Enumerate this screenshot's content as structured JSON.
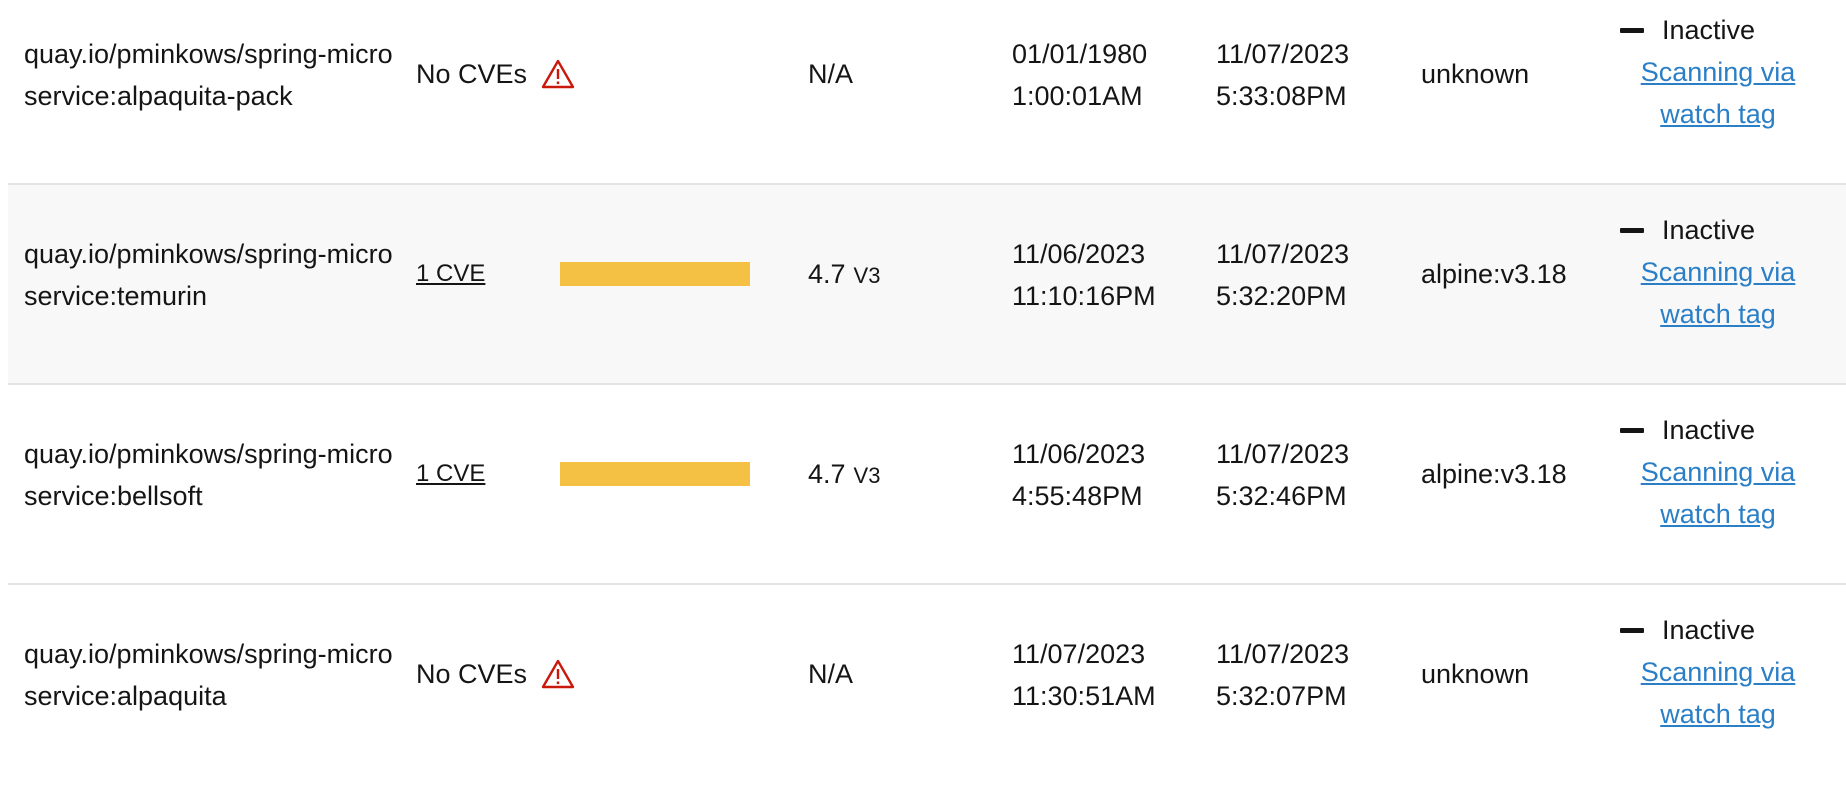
{
  "colors": {
    "severity_medium": "#f4c145",
    "link": "#2b7fc6",
    "warning": "#c9190b",
    "row_stripe": "#f8f8f8"
  },
  "icons": {
    "warning": "warning-triangle-icon",
    "status": "minus-icon"
  },
  "rows": [
    {
      "image": "quay.io/pminkows/spring-microservice:alpaquita-pack",
      "vulnerabilities": "No CVEs",
      "severity_fill": null,
      "score": "N/A",
      "score_version": "",
      "created": [
        "01/01/1980",
        "1:00:01AM"
      ],
      "modified": [
        "11/07/2023",
        "5:33:08PM"
      ],
      "base_image": "unknown",
      "status": "Inactive",
      "scan_link": "Scanning via watch tag"
    },
    {
      "image": "quay.io/pminkows/spring-microservice:temurin",
      "vulnerabilities": "1 CVE",
      "severity_fill": 1,
      "score": "4.7",
      "score_version": "V3",
      "created": [
        "11/06/2023",
        "11:10:16PM"
      ],
      "modified": [
        "11/07/2023",
        "5:32:20PM"
      ],
      "base_image": "alpine:v3.18",
      "status": "Inactive",
      "scan_link": "Scanning via watch tag"
    },
    {
      "image": "quay.io/pminkows/spring-microservice:bellsoft",
      "vulnerabilities": "1 CVE",
      "severity_fill": 1,
      "score": "4.7",
      "score_version": "V3",
      "created": [
        "11/06/2023",
        "4:55:48PM"
      ],
      "modified": [
        "11/07/2023",
        "5:32:46PM"
      ],
      "base_image": "alpine:v3.18",
      "status": "Inactive",
      "scan_link": "Scanning via watch tag"
    },
    {
      "image": "quay.io/pminkows/spring-microservice:alpaquita",
      "vulnerabilities": "No CVEs",
      "severity_fill": null,
      "score": "N/A",
      "score_version": "",
      "created": [
        "11/07/2023",
        "11:30:51AM"
      ],
      "modified": [
        "11/07/2023",
        "5:32:07PM"
      ],
      "base_image": "unknown",
      "status": "Inactive",
      "scan_link": "Scanning via watch tag"
    }
  ]
}
